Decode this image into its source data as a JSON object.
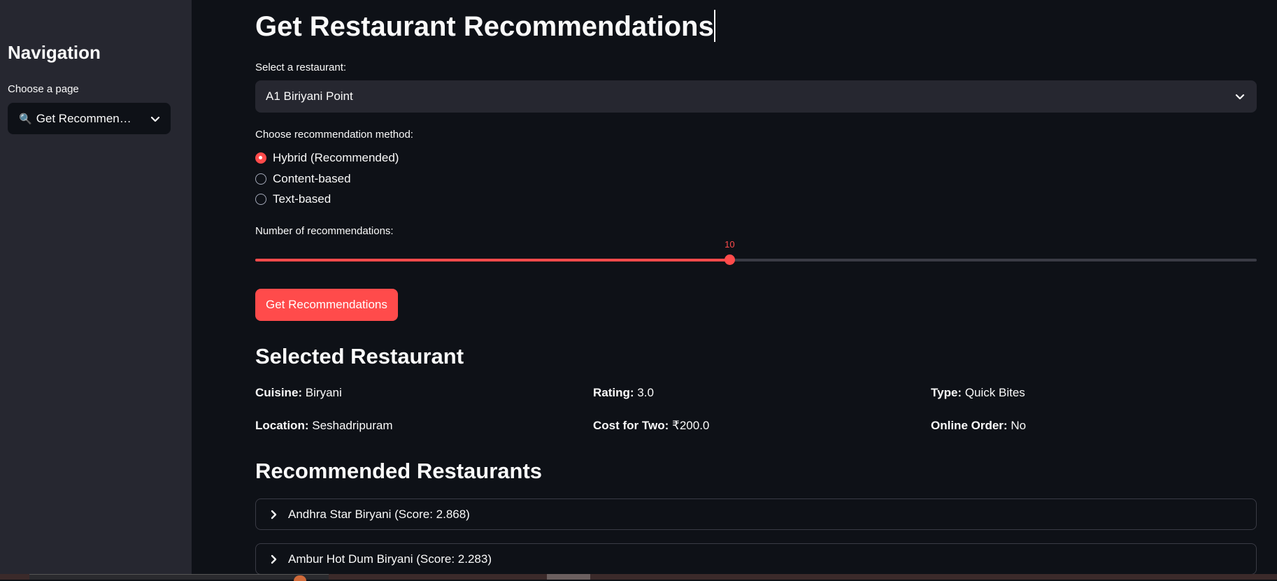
{
  "sidebar": {
    "title": "Navigation",
    "choose_label": "Choose a page",
    "page_select": {
      "icon": "magnifier-icon",
      "value": "Get Recommen…"
    }
  },
  "main": {
    "title": "Get Restaurant Recommendations",
    "restaurant_label": "Select a restaurant:",
    "restaurant_value": "A1 Biriyani Point",
    "method_label": "Choose recommendation method:",
    "methods": [
      {
        "label": "Hybrid (Recommended)",
        "selected": true
      },
      {
        "label": "Content-based",
        "selected": false
      },
      {
        "label": "Text-based",
        "selected": false
      }
    ],
    "count_label": "Number of recommendations:",
    "slider": {
      "value": "10",
      "fraction": 0.4737
    },
    "button_label": "Get Recommendations",
    "selected_heading": "Selected Restaurant",
    "details": {
      "cuisine_key": "Cuisine:",
      "cuisine_val": "Biryani",
      "rating_key": "Rating:",
      "rating_val": "3.0",
      "type_key": "Type:",
      "type_val": "Quick Bites",
      "location_key": "Location:",
      "location_val": "Seshadripuram",
      "cost_key": "Cost for Two:",
      "cost_val": "₹200.0",
      "online_key": "Online Order:",
      "online_val": "No"
    },
    "recommended_heading": "Recommended Restaurants",
    "recommendations": [
      "Andhra Star Biryani (Score: 2.868)",
      "Ambur Hot Dum Biryani (Score: 2.283)"
    ]
  },
  "colors": {
    "accent": "#ff4b4b",
    "background": "#0e1117",
    "sidebar": "#262730"
  }
}
